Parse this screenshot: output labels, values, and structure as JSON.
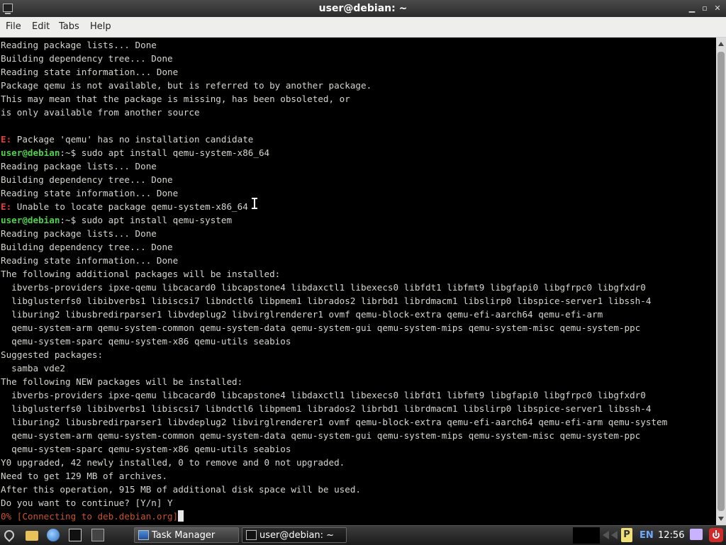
{
  "window": {
    "title": "user@debian: ~"
  },
  "menu": {
    "file": "File",
    "edit": "Edit",
    "tabs": "Tabs",
    "help": "Help"
  },
  "terminal": {
    "lines": [
      [
        {
          "t": "text",
          "v": "Reading package lists... Done"
        }
      ],
      [
        {
          "t": "text",
          "v": "Building dependency tree... Done"
        }
      ],
      [
        {
          "t": "text",
          "v": "Reading state information... Done"
        }
      ],
      [
        {
          "t": "text",
          "v": "Package qemu is not available, but is referred to by another package."
        }
      ],
      [
        {
          "t": "text",
          "v": "This may mean that the package is missing, has been obsoleted, or"
        }
      ],
      [
        {
          "t": "text",
          "v": "is only available from another source"
        }
      ],
      [],
      [
        {
          "t": "err",
          "v": "E:"
        },
        {
          "t": "text",
          "v": " Package 'qemu' has no installation candidate"
        }
      ],
      [
        {
          "t": "user",
          "v": "user@debian"
        },
        {
          "t": "sep",
          "v": ":~$"
        },
        {
          "t": "text",
          "v": " sudo apt install qemu-system-x86_64"
        }
      ],
      [
        {
          "t": "text",
          "v": "Reading package lists... Done"
        }
      ],
      [
        {
          "t": "text",
          "v": "Building dependency tree... Done"
        }
      ],
      [
        {
          "t": "text",
          "v": "Reading state information... Done"
        }
      ],
      [
        {
          "t": "err",
          "v": "E:"
        },
        {
          "t": "text",
          "v": " Unable to locate package qemu-system-x86_64"
        }
      ],
      [
        {
          "t": "user",
          "v": "user@debian"
        },
        {
          "t": "sep",
          "v": ":~$"
        },
        {
          "t": "text",
          "v": " sudo apt install qemu-system"
        }
      ],
      [
        {
          "t": "text",
          "v": "Reading package lists... Done"
        }
      ],
      [
        {
          "t": "text",
          "v": "Building dependency tree... Done"
        }
      ],
      [
        {
          "t": "text",
          "v": "Reading state information... Done"
        }
      ],
      [
        {
          "t": "text",
          "v": "The following additional packages will be installed:"
        }
      ],
      [
        {
          "t": "text",
          "v": "  ibverbs-providers ipxe-qemu libcacard0 libcapstone4 libdaxctl1 libexecs0 libfdt1 libfmt9 libgfapi0 libgfrpc0 libgfxdr0"
        }
      ],
      [
        {
          "t": "text",
          "v": "  libglusterfs0 libibverbs1 libiscsi7 libndctl6 libpmem1 librados2 librbd1 librdmacm1 libslirp0 libspice-server1 libssh-4"
        }
      ],
      [
        {
          "t": "text",
          "v": "  liburing2 libusbredirparser1 libvdeplug2 libvirglrenderer1 ovmf qemu-block-extra qemu-efi-aarch64 qemu-efi-arm"
        }
      ],
      [
        {
          "t": "text",
          "v": "  qemu-system-arm qemu-system-common qemu-system-data qemu-system-gui qemu-system-mips qemu-system-misc qemu-system-ppc"
        }
      ],
      [
        {
          "t": "text",
          "v": "  qemu-system-sparc qemu-system-x86 qemu-utils seabios"
        }
      ],
      [
        {
          "t": "text",
          "v": "Suggested packages:"
        }
      ],
      [
        {
          "t": "text",
          "v": "  samba vde2"
        }
      ],
      [
        {
          "t": "text",
          "v": "The following NEW packages will be installed:"
        }
      ],
      [
        {
          "t": "text",
          "v": "  ibverbs-providers ipxe-qemu libcacard0 libcapstone4 libdaxctl1 libexecs0 libfdt1 libfmt9 libgfapi0 libgfrpc0 libgfxdr0"
        }
      ],
      [
        {
          "t": "text",
          "v": "  libglusterfs0 libibverbs1 libiscsi7 libndctl6 libpmem1 librados2 librbd1 librdmacm1 libslirp0 libspice-server1 libssh-4"
        }
      ],
      [
        {
          "t": "text",
          "v": "  liburing2 libusbredirparser1 libvdeplug2 libvirglrenderer1 ovmf qemu-block-extra qemu-efi-aarch64 qemu-efi-arm qemu-system"
        }
      ],
      [
        {
          "t": "text",
          "v": "  qemu-system-arm qemu-system-common qemu-system-data qemu-system-gui qemu-system-mips qemu-system-misc qemu-system-ppc"
        }
      ],
      [
        {
          "t": "text",
          "v": "  qemu-system-sparc qemu-system-x86 qemu-utils seabios"
        }
      ],
      [
        {
          "t": "text",
          "v": "Y0 upgraded, 42 newly installed, 0 to remove and 0 not upgraded."
        }
      ],
      [
        {
          "t": "text",
          "v": "Need to get 129 MB of archives."
        }
      ],
      [
        {
          "t": "text",
          "v": "After this operation, 915 MB of additional disk space will be used."
        }
      ],
      [
        {
          "t": "text",
          "v": "Do you want to continue? [Y/n] Y"
        }
      ],
      [
        {
          "t": "progress",
          "v": "0% [Connecting to deb.debian.org]"
        },
        {
          "t": "cursor",
          "v": ""
        }
      ]
    ]
  },
  "taskbar": {
    "task_manager_label": "Task Manager",
    "terminal_label": "user@debian: ~",
    "language": "EN",
    "clock": "12:56"
  }
}
